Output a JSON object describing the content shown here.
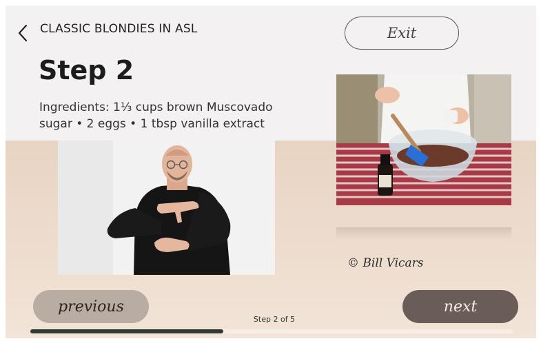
{
  "header": {
    "back_icon": "chevron-left-icon",
    "title": "CLASSIC BLONDIES IN ASL",
    "exit_label": "Exit"
  },
  "step": {
    "title": "Step 2",
    "ingredients": "Ingredients: 1⅓ cups brown Muscovado sugar • 2 eggs • 1 tbsp vanilla extract"
  },
  "media": {
    "credit": "© Bill Vicars"
  },
  "navigation": {
    "previous_label": "previous",
    "next_label": "next",
    "step_counter": "Step 2 of 5",
    "progress": 0.4
  },
  "colors": {
    "top_band": "#f3f1f2",
    "previous_button": "#b9aca2",
    "next_button": "#6a5c56",
    "progress_fill": "#2f3a33"
  }
}
